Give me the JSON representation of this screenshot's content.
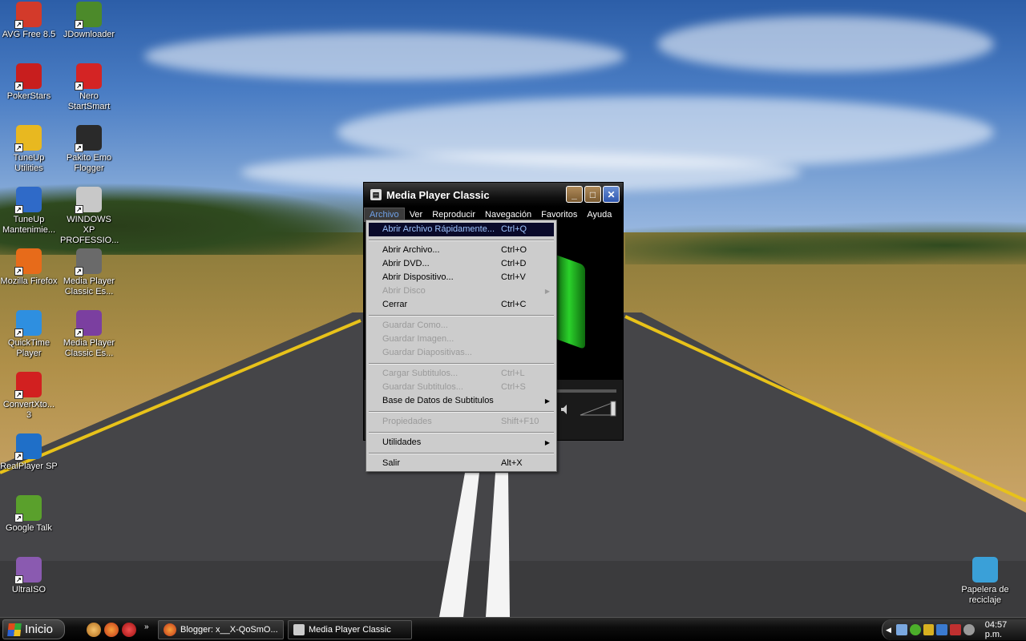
{
  "desktop": {
    "icons": [
      {
        "label": "AVG Free 8.5",
        "icon": "avg-icon",
        "color": "#d33a2a"
      },
      {
        "label": "JDownloader",
        "icon": "jdownloader-icon",
        "color": "#4c8a2a"
      },
      {
        "label": "PokerStars",
        "icon": "pokerstars-icon",
        "color": "#c81e1e"
      },
      {
        "label": "Nero StartSmart",
        "icon": "nero-icon",
        "color": "#d42424"
      },
      {
        "label": "TuneUp Utilities",
        "icon": "tuneup-icon",
        "color": "#e8b820"
      },
      {
        "label": "Pakito Emo Flogger",
        "icon": "divx-icon",
        "color": "#2a2a2a"
      },
      {
        "label": "TuneUp Mantenimie...",
        "icon": "tuneup-maint-icon",
        "color": "#2f6ac8"
      },
      {
        "label": "WINDOWS XP PROFESSIO...",
        "icon": "disc-icon",
        "color": "#c8c8c8"
      },
      {
        "label": "Mozilla Firefox",
        "icon": "firefox-icon",
        "color": "#e76b1a"
      },
      {
        "label": "Media Player Classic Es...",
        "icon": "mpc-icon",
        "color": "#6a6a6a"
      },
      {
        "label": "QuickTime Player",
        "icon": "quicktime-icon",
        "color": "#2e8fe0"
      },
      {
        "label": "Media Player Classic Es...",
        "icon": "winrar-icon",
        "color": "#7b3fa0"
      },
      {
        "label": "ConvertXto... 3",
        "icon": "convertx-icon",
        "color": "#d22020"
      },
      {
        "label": "RealPlayer SP",
        "icon": "realplayer-icon",
        "color": "#1f6fc8"
      },
      {
        "label": "Google Talk",
        "icon": "google-talk-icon",
        "color": "#5aa02c"
      },
      {
        "label": "UltraISO",
        "icon": "ultraiso-icon",
        "color": "#8a5ab0"
      },
      {
        "label": "Papelera de reciclaje",
        "icon": "recycle-bin-icon",
        "color": "#3aa0d8"
      }
    ]
  },
  "window": {
    "title": "Media Player Classic",
    "menus": [
      "Archivo",
      "Ver",
      "Reproducir",
      "Navegación",
      "Favoritos",
      "Ayuda"
    ]
  },
  "archivo_menu": {
    "items": [
      {
        "label": "Abrir Archivo Rápidamente...",
        "shortcut": "Ctrl+Q",
        "state": "highlighted"
      },
      {
        "type": "separator"
      },
      {
        "label": "Abrir Archivo...",
        "shortcut": "Ctrl+O",
        "state": "enabled"
      },
      {
        "label": "Abrir DVD...",
        "shortcut": "Ctrl+D",
        "state": "enabled"
      },
      {
        "label": "Abrir Dispositivo...",
        "shortcut": "Ctrl+V",
        "state": "enabled"
      },
      {
        "label": "Abrir Disco",
        "shortcut": "",
        "state": "disabled",
        "submenu": true
      },
      {
        "label": "Cerrar",
        "shortcut": "Ctrl+C",
        "state": "enabled"
      },
      {
        "type": "separator"
      },
      {
        "label": "Guardar Como...",
        "shortcut": "",
        "state": "disabled"
      },
      {
        "label": "Guardar Imagen...",
        "shortcut": "",
        "state": "disabled"
      },
      {
        "label": "Guardar Diapositivas...",
        "shortcut": "",
        "state": "disabled"
      },
      {
        "type": "separator"
      },
      {
        "label": "Cargar Subtitulos...",
        "shortcut": "Ctrl+L",
        "state": "disabled"
      },
      {
        "label": "Guardar Subtitulos...",
        "shortcut": "Ctrl+S",
        "state": "disabled"
      },
      {
        "label": "Base de Datos de Subtitulos",
        "shortcut": "",
        "state": "enabled",
        "submenu": true
      },
      {
        "type": "separator"
      },
      {
        "label": "Propiedades",
        "shortcut": "Shift+F10",
        "state": "disabled"
      },
      {
        "type": "separator"
      },
      {
        "label": "Utilidades",
        "shortcut": "",
        "state": "enabled",
        "submenu": true
      },
      {
        "type": "separator"
      },
      {
        "label": "Salir",
        "shortcut": "Alt+X",
        "state": "enabled"
      }
    ]
  },
  "taskbar": {
    "start_label": "Inicio",
    "tasks": [
      {
        "label": "Blogger: x__X-QoSmO...",
        "icon": "firefox-icon"
      },
      {
        "label": "Media Player Classic",
        "icon": "mpc-icon"
      }
    ],
    "clock": "04:57 p.m."
  }
}
